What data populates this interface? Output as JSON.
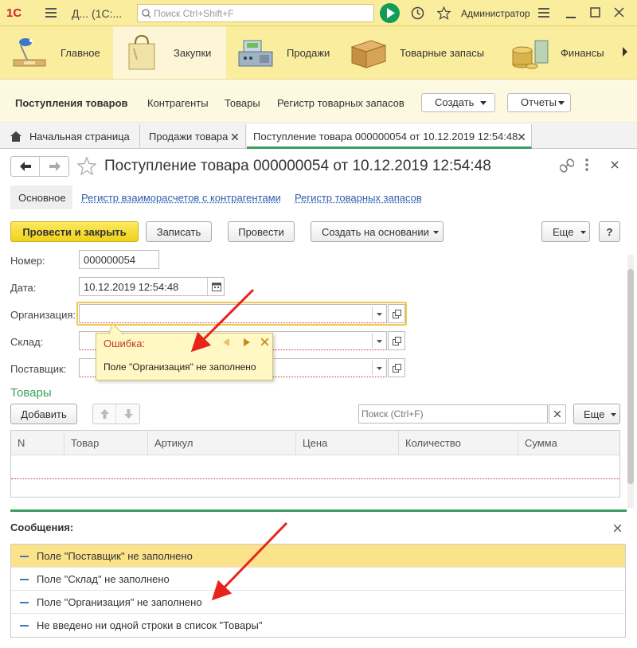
{
  "titlebar": {
    "logo": "1С",
    "app_title": "Д...  (1С:...",
    "search_placeholder": "Поиск Ctrl+Shift+F",
    "user": "Администратор"
  },
  "sections": [
    {
      "label": "Главное",
      "icon": "desk-lamp-icon"
    },
    {
      "label": "Закупки",
      "icon": "shopping-bag-icon"
    },
    {
      "label": "Продажи",
      "icon": "cash-register-icon"
    },
    {
      "label": "Товарные запасы",
      "icon": "box-icon"
    },
    {
      "label": "Финансы",
      "icon": "coins-icon"
    }
  ],
  "funcpanel": {
    "items": [
      "Поступления товаров",
      "Контрагенты",
      "Товары",
      "Регистр товарных запасов"
    ],
    "create": "Создать",
    "reports": "Отчеты"
  },
  "tabs": [
    {
      "label": "Начальная страница"
    },
    {
      "label": "Продажи товара"
    },
    {
      "label": "Поступление товара 000000054 от 10.12.2019 12:54:48"
    }
  ],
  "form": {
    "title": "Поступление товара 000000054 от 10.12.2019 12:54:48",
    "nav": [
      "Основное",
      "Регистр взаиморасчетов с контрагентами",
      "Регистр товарных запасов"
    ],
    "buttons": {
      "post_close": "Провести и закрыть",
      "save": "Записать",
      "post": "Провести",
      "create_based": "Создать на основании",
      "more": "Еще",
      "help": "?"
    },
    "fields": {
      "number_label": "Номер:",
      "number_value": "000000054",
      "date_label": "Дата:",
      "date_value": "10.12.2019 12:54:48",
      "org_label": "Организация:",
      "warehouse_label": "Склад:",
      "supplier_label": "Поставщик:"
    },
    "popup": {
      "title": "Ошибка:",
      "text": "Поле \"Организация\" не заполнено"
    },
    "goods": {
      "title": "Товары",
      "add": "Добавить",
      "search_placeholder": "Поиск (Ctrl+F)",
      "more": "Еще",
      "columns": [
        "N",
        "Товар",
        "Артикул",
        "Цена",
        "Количество",
        "Сумма"
      ]
    }
  },
  "messages": {
    "title": "Сообщения:",
    "items": [
      "Поле \"Поставщик\" не заполнено",
      "Поле \"Склад\" не заполнено",
      "Поле \"Организация\" не заполнено",
      "Не введено ни одной строки в список \"Товары\""
    ]
  },
  "colors": {
    "accent_yellow": "#fbed9e",
    "primary_button": "#f1d319",
    "green": "#3a9e5e",
    "link": "#2a5db0",
    "error_red": "#e8231c"
  }
}
